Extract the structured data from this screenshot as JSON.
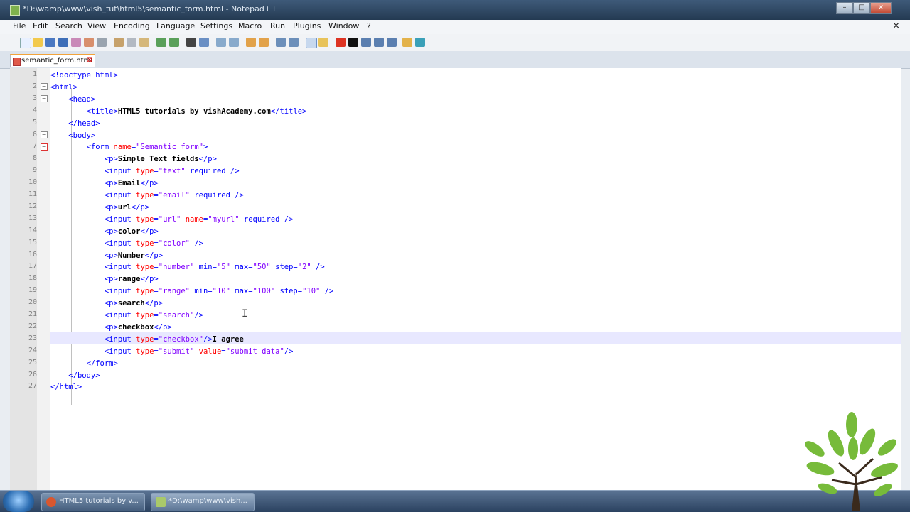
{
  "window": {
    "title": "*D:\\wamp\\www\\vish_tut\\html5\\semantic_form.html - Notepad++"
  },
  "menu": [
    "File",
    "Edit",
    "Search",
    "View",
    "Encoding",
    "Language",
    "Settings",
    "Macro",
    "Run",
    "Plugins",
    "Window",
    "?"
  ],
  "tab": {
    "label": "semantic_form.html"
  },
  "editor": {
    "line_numbers": [
      "1",
      "2",
      "3",
      "4",
      "5",
      "6",
      "7",
      "8",
      "9",
      "10",
      "11",
      "12",
      "13",
      "14",
      "15",
      "16",
      "17",
      "18",
      "19",
      "20",
      "21",
      "22",
      "23",
      "24",
      "25",
      "26",
      "27"
    ],
    "current_line": 23
  },
  "code_lines": [
    [
      [
        "t",
        "<!doctype html>"
      ]
    ],
    [
      [
        "t",
        "<html>"
      ]
    ],
    [
      [
        "s",
        "    "
      ],
      [
        "t",
        "<head>"
      ]
    ],
    [
      [
        "s",
        "        "
      ],
      [
        "t",
        "<title>"
      ],
      [
        "x",
        "HTML5 tutorials by vishAcademy.com"
      ],
      [
        "t",
        "</title>"
      ]
    ],
    [
      [
        "s",
        "    "
      ],
      [
        "t",
        "</head>"
      ]
    ],
    [
      [
        "s",
        "    "
      ],
      [
        "t",
        "<body>"
      ]
    ],
    [
      [
        "s",
        "        "
      ],
      [
        "t",
        "<form "
      ],
      [
        "a",
        "name"
      ],
      [
        "t",
        "="
      ],
      [
        "v",
        "\"Semantic_form\""
      ],
      [
        "t",
        ">"
      ]
    ],
    [
      [
        "s",
        "            "
      ],
      [
        "t",
        "<p>"
      ],
      [
        "x",
        "Simple Text fields"
      ],
      [
        "t",
        "</p>"
      ]
    ],
    [
      [
        "s",
        "            "
      ],
      [
        "t",
        "<input "
      ],
      [
        "a",
        "type"
      ],
      [
        "t",
        "="
      ],
      [
        "v",
        "\"text\""
      ],
      [
        "t",
        " required />"
      ]
    ],
    [
      [
        "s",
        "            "
      ],
      [
        "t",
        "<p>"
      ],
      [
        "x",
        "Email"
      ],
      [
        "t",
        "</p>"
      ]
    ],
    [
      [
        "s",
        "            "
      ],
      [
        "t",
        "<input "
      ],
      [
        "a",
        "type"
      ],
      [
        "t",
        "="
      ],
      [
        "v",
        "\"email\""
      ],
      [
        "t",
        " required />"
      ]
    ],
    [
      [
        "s",
        "            "
      ],
      [
        "t",
        "<p>"
      ],
      [
        "x",
        "url"
      ],
      [
        "t",
        "</p>"
      ]
    ],
    [
      [
        "s",
        "            "
      ],
      [
        "t",
        "<input "
      ],
      [
        "a",
        "type"
      ],
      [
        "t",
        "="
      ],
      [
        "v",
        "\"url\""
      ],
      [
        "t",
        " "
      ],
      [
        "a",
        "name"
      ],
      [
        "t",
        "="
      ],
      [
        "v",
        "\"myurl\""
      ],
      [
        "t",
        " required />"
      ]
    ],
    [
      [
        "s",
        "            "
      ],
      [
        "t",
        "<p>"
      ],
      [
        "x",
        "color"
      ],
      [
        "t",
        "</p>"
      ]
    ],
    [
      [
        "s",
        "            "
      ],
      [
        "t",
        "<input "
      ],
      [
        "a",
        "type"
      ],
      [
        "t",
        "="
      ],
      [
        "v",
        "\"color\""
      ],
      [
        "t",
        " />"
      ]
    ],
    [
      [
        "s",
        "            "
      ],
      [
        "t",
        "<p>"
      ],
      [
        "x",
        "Number"
      ],
      [
        "t",
        "</p>"
      ]
    ],
    [
      [
        "s",
        "            "
      ],
      [
        "t",
        "<input "
      ],
      [
        "a",
        "type"
      ],
      [
        "t",
        "="
      ],
      [
        "v",
        "\"number\""
      ],
      [
        "t",
        " min="
      ],
      [
        "v",
        "\"5\""
      ],
      [
        "t",
        " max="
      ],
      [
        "v",
        "\"50\""
      ],
      [
        "t",
        " step="
      ],
      [
        "v",
        "\"2\""
      ],
      [
        "t",
        " />"
      ]
    ],
    [
      [
        "s",
        "            "
      ],
      [
        "t",
        "<p>"
      ],
      [
        "x",
        "range"
      ],
      [
        "t",
        "</p>"
      ]
    ],
    [
      [
        "s",
        "            "
      ],
      [
        "t",
        "<input "
      ],
      [
        "a",
        "type"
      ],
      [
        "t",
        "="
      ],
      [
        "v",
        "\"range\""
      ],
      [
        "t",
        " min="
      ],
      [
        "v",
        "\"10\""
      ],
      [
        "t",
        " max="
      ],
      [
        "v",
        "\"100\""
      ],
      [
        "t",
        " step="
      ],
      [
        "v",
        "\"10\""
      ],
      [
        "t",
        " />"
      ]
    ],
    [
      [
        "s",
        "            "
      ],
      [
        "t",
        "<p>"
      ],
      [
        "x",
        "search"
      ],
      [
        "t",
        "</p>"
      ]
    ],
    [
      [
        "s",
        "            "
      ],
      [
        "t",
        "<input "
      ],
      [
        "a",
        "type"
      ],
      [
        "t",
        "="
      ],
      [
        "v",
        "\"search\""
      ],
      [
        "t",
        "/>"
      ]
    ],
    [
      [
        "s",
        "            "
      ],
      [
        "t",
        "<p>"
      ],
      [
        "x",
        "checkbox"
      ],
      [
        "t",
        "</p>"
      ]
    ],
    [
      [
        "s",
        "            "
      ],
      [
        "t",
        "<input "
      ],
      [
        "a",
        "type"
      ],
      [
        "t",
        "="
      ],
      [
        "v",
        "\"checkbox\""
      ],
      [
        "t",
        "/>"
      ],
      [
        "x",
        "I agree"
      ]
    ],
    [
      [
        "s",
        "            "
      ],
      [
        "t",
        "<input "
      ],
      [
        "a",
        "type"
      ],
      [
        "t",
        "="
      ],
      [
        "v",
        "\"submit\""
      ],
      [
        "t",
        " "
      ],
      [
        "a",
        "value"
      ],
      [
        "t",
        "="
      ],
      [
        "v",
        "\"submit data\""
      ],
      [
        "t",
        "/>"
      ]
    ],
    [
      [
        "s",
        "        "
      ],
      [
        "t",
        "</form>"
      ]
    ],
    [
      [
        "s",
        "    "
      ],
      [
        "t",
        "</body>"
      ]
    ],
    [
      [
        "t",
        "</html>"
      ]
    ]
  ],
  "taskbar": {
    "items": [
      "HTML5 tutorials by v...",
      "*D:\\wamp\\www\\vish..."
    ]
  },
  "colors": {
    "tag": "#0000ff",
    "attribute": "#ff0000",
    "value": "#8000ff",
    "current_line": "#e8e8ff",
    "titlebar": "#2f4862"
  }
}
